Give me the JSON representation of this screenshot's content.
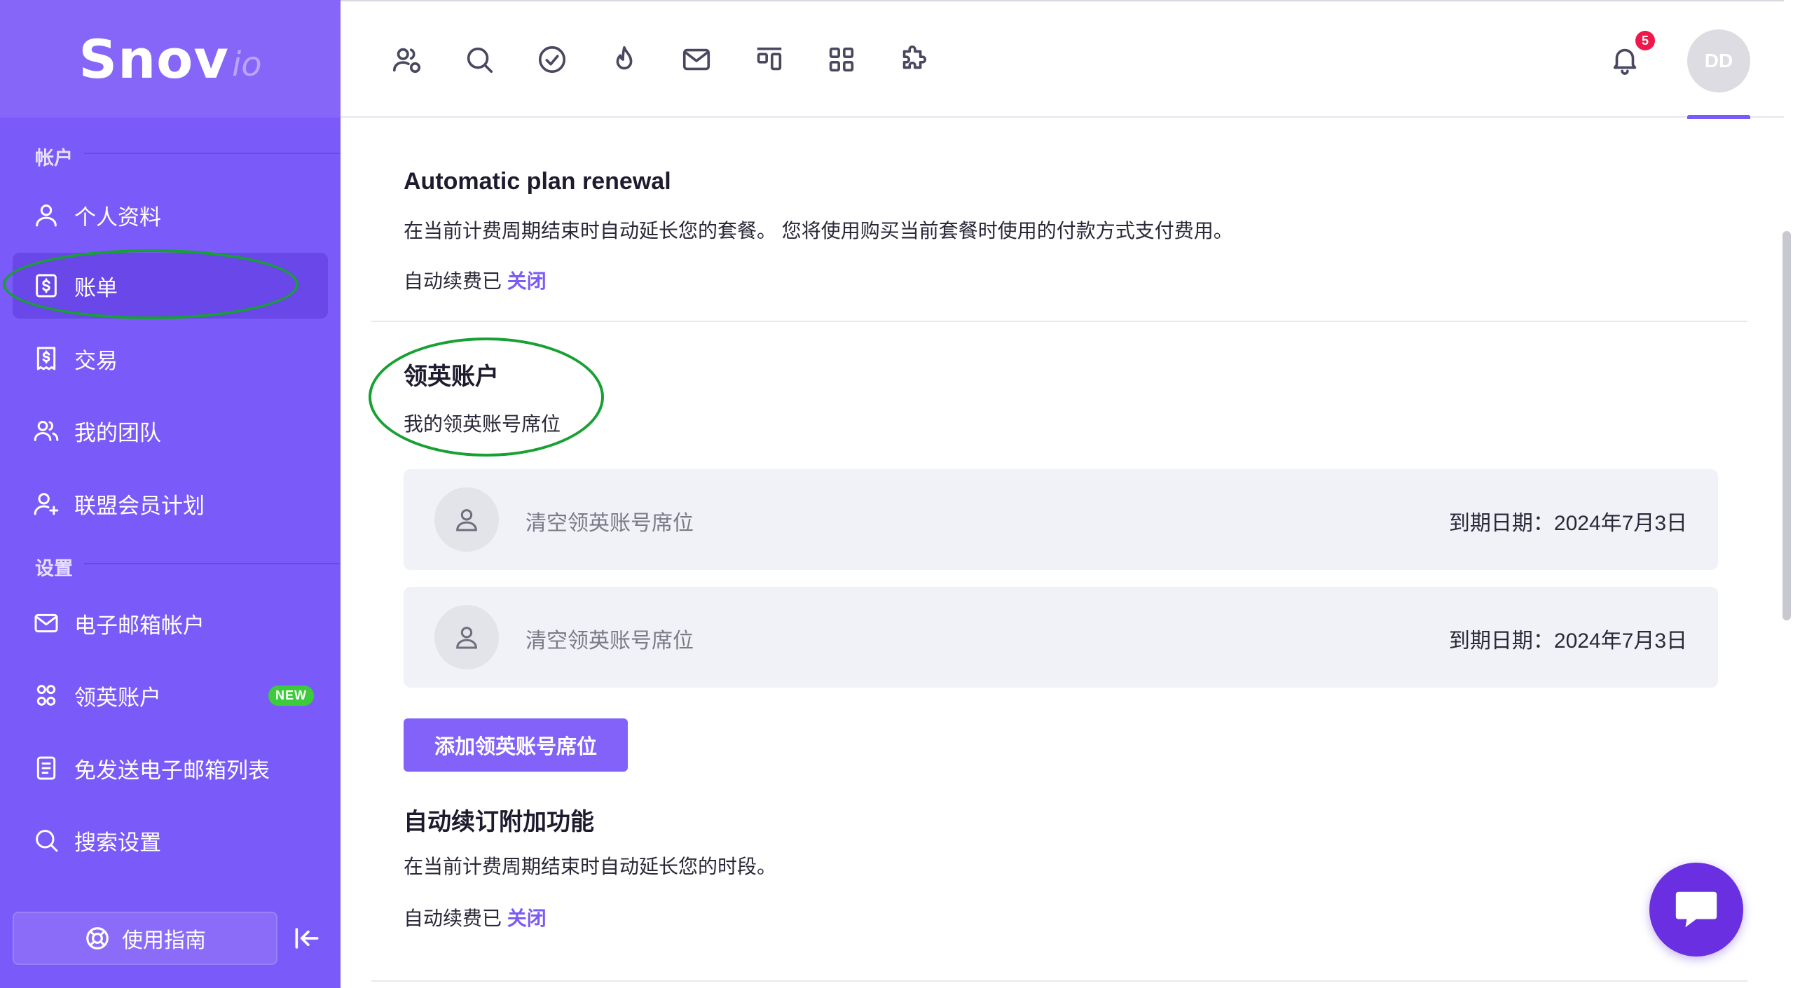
{
  "brand": {
    "name": "Snov",
    "suffix": "io"
  },
  "sidebar": {
    "account_section": "帐户",
    "settings_section": "设置",
    "items": [
      {
        "label": "个人资料",
        "icon": "user-icon"
      },
      {
        "label": "账单",
        "icon": "billing-icon",
        "active": true
      },
      {
        "label": "交易",
        "icon": "receipt-icon"
      },
      {
        "label": "我的团队",
        "icon": "team-icon"
      },
      {
        "label": "联盟会员计划",
        "icon": "user-plus-icon"
      },
      {
        "label": "电子邮箱帐户",
        "icon": "mail-icon"
      },
      {
        "label": "领英账户",
        "icon": "linkedin-accounts-icon",
        "badge": "NEW"
      },
      {
        "label": "免发送电子邮箱列表",
        "icon": "document-icon"
      },
      {
        "label": "搜索设置",
        "icon": "search-icon"
      }
    ],
    "guide_label": "使用指南"
  },
  "topbar": {
    "icons": [
      "prospects-icon",
      "search-icon",
      "check-circle-icon",
      "fire-icon",
      "mail-icon",
      "pipeline-icon",
      "apps-icon",
      "puzzle-icon"
    ],
    "notification_count": "5",
    "avatar_initials": "DD"
  },
  "main": {
    "renewal": {
      "title": "Automatic plan renewal",
      "description": "在当前计费周期结束时自动延长您的套餐。 您将使用购买当前套餐时使用的付款方式支付费用。",
      "status_prefix": "自动续费已",
      "status_value": "关闭"
    },
    "linkedin": {
      "title": "领英账户",
      "subtitle": "我的领英账号席位",
      "seats": [
        {
          "label": "清空领英账号席位",
          "expiry": "到期日期：2024年7月3日"
        },
        {
          "label": "清空领英账号席位",
          "expiry": "到期日期：2024年7月3日"
        }
      ],
      "add_button": "添加领英账号席位"
    },
    "addons": {
      "title": "自动续订附加功能",
      "description": "在当前计费周期结束时自动延长您的时段。",
      "status_prefix": "自动续费已",
      "status_value": "关闭"
    }
  },
  "colors": {
    "sidebar": "#7a5af8",
    "accent": "#7a5af8",
    "annotation": "#17a033",
    "badge": "#3ccb3c",
    "notification": "#f0174b",
    "chat": "#6a2fe0"
  }
}
